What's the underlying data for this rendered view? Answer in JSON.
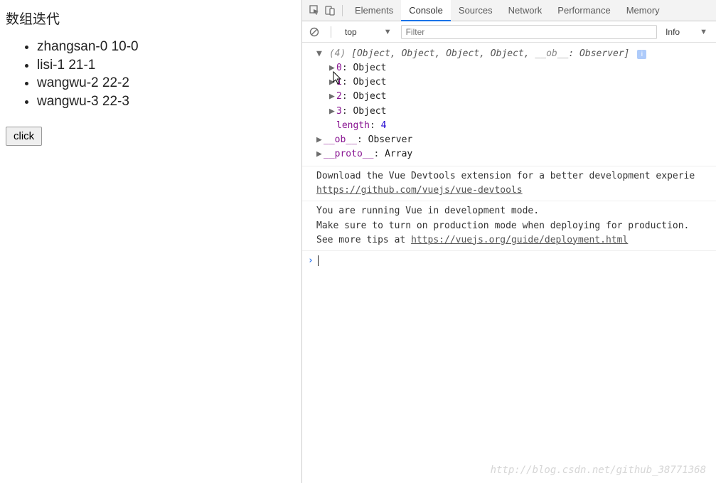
{
  "page": {
    "heading": "数组迭代",
    "items": [
      "zhangsan-0 10-0",
      "lisi-1 21-1",
      "wangwu-2 22-2",
      "wangwu-3 22-3"
    ],
    "button_label": "click"
  },
  "devtools": {
    "tabs": [
      "Elements",
      "Console",
      "Sources",
      "Network",
      "Performance",
      "Memory"
    ],
    "active_tab": "Console",
    "context": "top",
    "filter_placeholder": "Filter",
    "level": "Info"
  },
  "console": {
    "array_log": {
      "count_text": "(4)",
      "summary": "[Object, Object, Object, Object, ",
      "ob_key": "__ob__",
      "ob_val": ": Observer]",
      "items": [
        {
          "idx": "0",
          "val": "Object"
        },
        {
          "idx": "1",
          "val": "Object"
        },
        {
          "idx": "2",
          "val": "Object"
        },
        {
          "idx": "3",
          "val": "Object"
        }
      ],
      "length_key": "length",
      "length_val": "4",
      "ob_line_key": "__ob__",
      "ob_line_val": "Observer",
      "proto_key": "__proto__",
      "proto_val": "Array"
    },
    "devtools_msg_1": "Download the Vue Devtools extension for a better development experie",
    "devtools_link_1": "https://github.com/vuejs/vue-devtools",
    "vue_msg_1": "You are running Vue in development mode.",
    "vue_msg_2": "Make sure to turn on production mode when deploying for production.",
    "vue_msg_3": "See more tips at ",
    "vue_link": "https://vuejs.org/guide/deployment.html"
  },
  "watermark": "http://blog.csdn.net/github_38771368"
}
